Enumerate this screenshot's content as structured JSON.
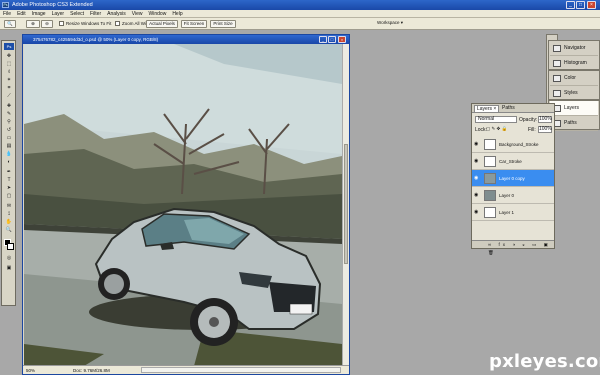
{
  "app": {
    "title": "Adobe Photoshop CS3 Extended"
  },
  "menu": [
    "File",
    "Edit",
    "Image",
    "Layer",
    "Select",
    "Filter",
    "Analysis",
    "View",
    "Window",
    "Help"
  ],
  "options": {
    "resize_windows_label": "Resize Windows To Fit",
    "zoom_all_label": "Zoom All Windows",
    "actual_pixels": "Actual Pixels",
    "fit_screen": "Fit Screen",
    "print_size": "Print Size",
    "workspace": "Workspace ▾"
  },
  "document": {
    "title": "375476782_c425594d3d_o.psd @ 50% (Layer 0 copy, RGB/8)",
    "zoom": "50%",
    "doc_size": "Doc: 9.76M/26.8M"
  },
  "dock": {
    "group1": [
      "Navigator",
      "Histogram"
    ],
    "group2": [
      "Color",
      "Styles"
    ],
    "group3": [
      "Layers",
      "Paths"
    ]
  },
  "layers_panel": {
    "tabs": [
      "Layers ×",
      "Paths"
    ],
    "blend_mode": "Normal",
    "opacity_label": "Opacity:",
    "opacity": "100%",
    "lock_label": "Lock:",
    "fill_label": "Fill:",
    "fill": "100%",
    "layers": [
      {
        "name": "Background_Stroke",
        "selected": false
      },
      {
        "name": "Car_Stroke",
        "selected": false
      },
      {
        "name": "Layer 0 copy",
        "selected": true
      },
      {
        "name": "Layer 0",
        "selected": false
      },
      {
        "name": "Layer 1",
        "selected": false
      }
    ]
  },
  "watermark": "pxleyes.com",
  "colors": {
    "accent": "#2f68d0",
    "selected_layer": "#3a8df0"
  }
}
